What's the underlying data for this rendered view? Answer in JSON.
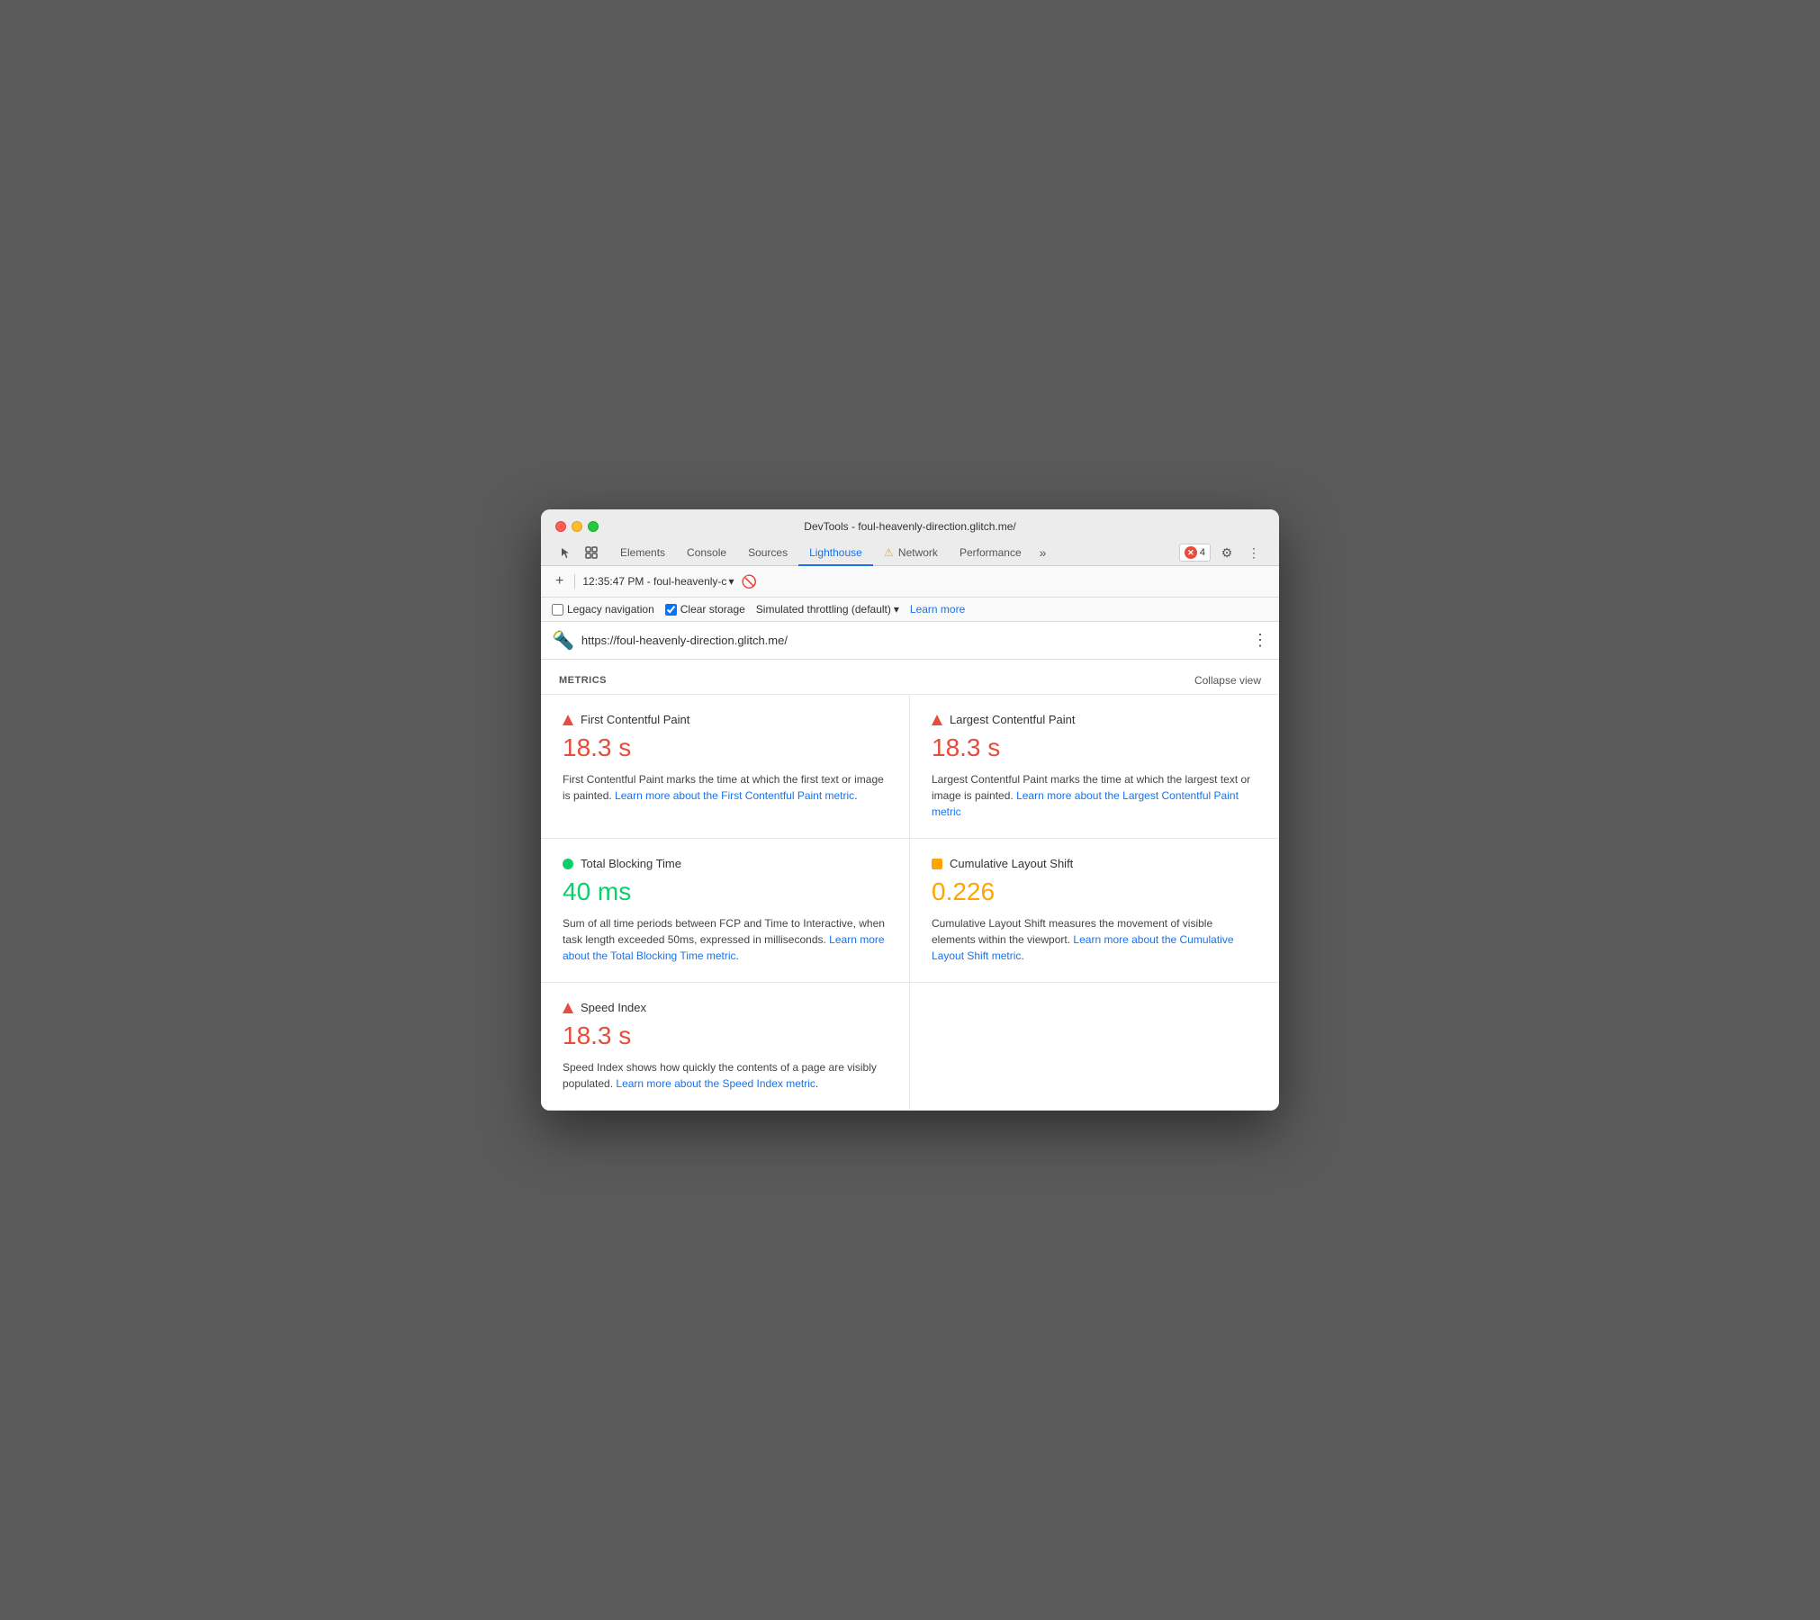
{
  "window": {
    "title": "DevTools - foul-heavenly-direction.glitch.me/"
  },
  "tabs": {
    "elements": "Elements",
    "console": "Console",
    "sources": "Sources",
    "lighthouse": "Lighthouse",
    "network": "Network",
    "performance": "Performance",
    "more": "»"
  },
  "toolbar": {
    "add_label": "+",
    "timestamp": "12:35:47 PM - foul-heavenly-c",
    "dropdown_arrow": "▾"
  },
  "options": {
    "legacy_navigation_label": "Legacy navigation",
    "clear_storage_label": "Clear storage",
    "throttling_label": "Simulated throttling (default)",
    "learn_more_label": "Learn more"
  },
  "url_bar": {
    "url": "https://foul-heavenly-direction.glitch.me/",
    "more_icon": "⋮"
  },
  "metrics": {
    "section_title": "METRICS",
    "collapse_label": "Collapse view",
    "items": [
      {
        "id": "fcp",
        "indicator": "red",
        "name": "First Contentful Paint",
        "value": "18.3 s",
        "value_color": "red",
        "description": "First Contentful Paint marks the time at which the first text or image is painted.",
        "link_text": "Learn more about the First Contentful Paint metric",
        "link_url": "#"
      },
      {
        "id": "lcp",
        "indicator": "red",
        "name": "Largest Contentful Paint",
        "value": "18.3 s",
        "value_color": "red",
        "description": "Largest Contentful Paint marks the time at which the largest text or image is painted.",
        "link_text": "Learn more about the Largest Contentful Paint metric",
        "link_url": "#"
      },
      {
        "id": "tbt",
        "indicator": "green",
        "name": "Total Blocking Time",
        "value": "40 ms",
        "value_color": "green",
        "description": "Sum of all time periods between FCP and Time to Interactive, when task length exceeded 50ms, expressed in milliseconds.",
        "link_text": "Learn more about the Total Blocking Time metric",
        "link_url": "#"
      },
      {
        "id": "cls",
        "indicator": "orange",
        "name": "Cumulative Layout Shift",
        "value": "0.226",
        "value_color": "orange",
        "description": "Cumulative Layout Shift measures the movement of visible elements within the viewport.",
        "link_text": "Learn more about the Cumulative Layout Shift metric",
        "link_url": "#"
      },
      {
        "id": "si",
        "indicator": "red",
        "name": "Speed Index",
        "value": "18.3 s",
        "value_color": "red",
        "description": "Speed Index shows how quickly the contents of a page are visibly populated.",
        "link_text": "Learn more about the Speed Index metric",
        "link_url": "#"
      }
    ]
  },
  "errors": {
    "count": "4"
  }
}
